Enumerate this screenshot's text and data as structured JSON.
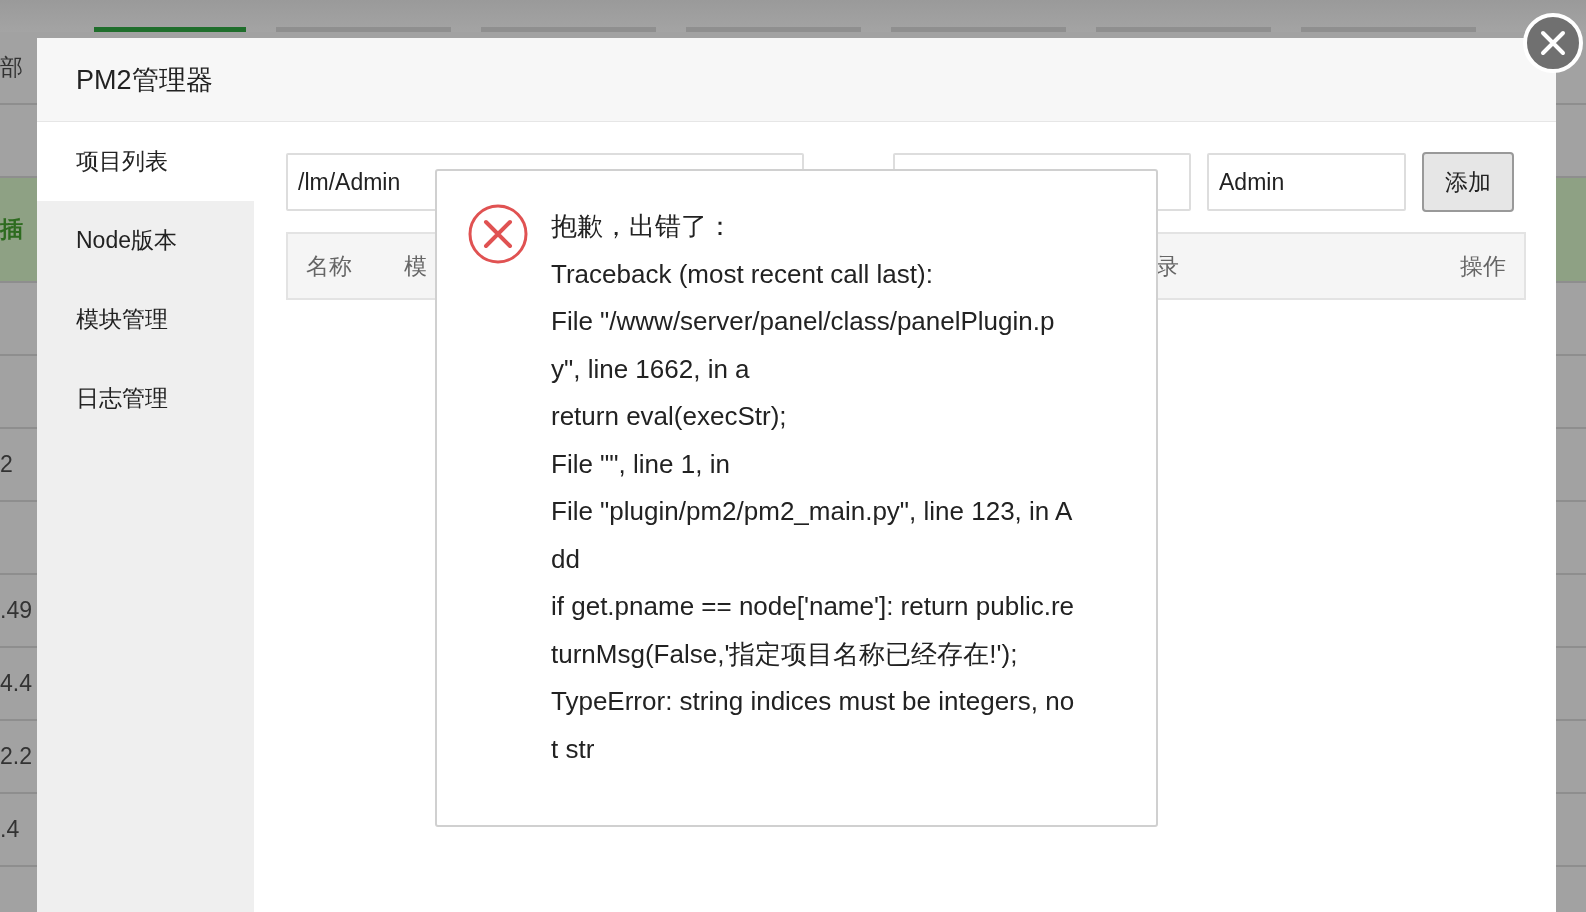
{
  "background": {
    "rows": [
      {
        "kind": "plain",
        "text": "部"
      },
      {
        "kind": "plain"
      },
      {
        "kind": "highlight",
        "text": "插"
      },
      {
        "kind": "plain"
      },
      {
        "kind": "plain"
      },
      {
        "kind": "plain",
        "text": "2"
      },
      {
        "kind": "plain"
      },
      {
        "kind": "plain",
        "text": ".49"
      },
      {
        "kind": "plain",
        "text": "4.4"
      },
      {
        "kind": "plain",
        "text": "2.2"
      },
      {
        "kind": "plain",
        "text": ".4"
      },
      {
        "kind": "plain"
      }
    ]
  },
  "dialog": {
    "title": "PM2管理器",
    "sidebar": {
      "items": [
        {
          "label": "项目列表",
          "selected": true
        },
        {
          "label": "Node版本",
          "selected": false
        },
        {
          "label": "模块管理",
          "selected": false
        },
        {
          "label": "日志管理",
          "selected": false
        }
      ]
    },
    "form": {
      "path_value": "/lm/Admin",
      "user_value": "Admin",
      "add_button": "添加"
    },
    "table": {
      "columns": [
        "名称",
        "模",
        "录",
        "操作"
      ]
    }
  },
  "error": {
    "title": "抱歉，出错了：",
    "lines": [
      "Traceback (most recent call last):",
      "File \"/www/server/panel/class/panelPlugin.p",
      "y\", line 1662, in a",
      "return eval(execStr);",
      "File \"\", line 1, in",
      "File \"plugin/pm2/pm2_main.py\", line 123, in A",
      "dd",
      "if get.pname == node['name']: return public.re",
      "turnMsg(False,'指定项目名称已经存在!');",
      "TypeError: string indices must be integers, no",
      "t str"
    ]
  }
}
